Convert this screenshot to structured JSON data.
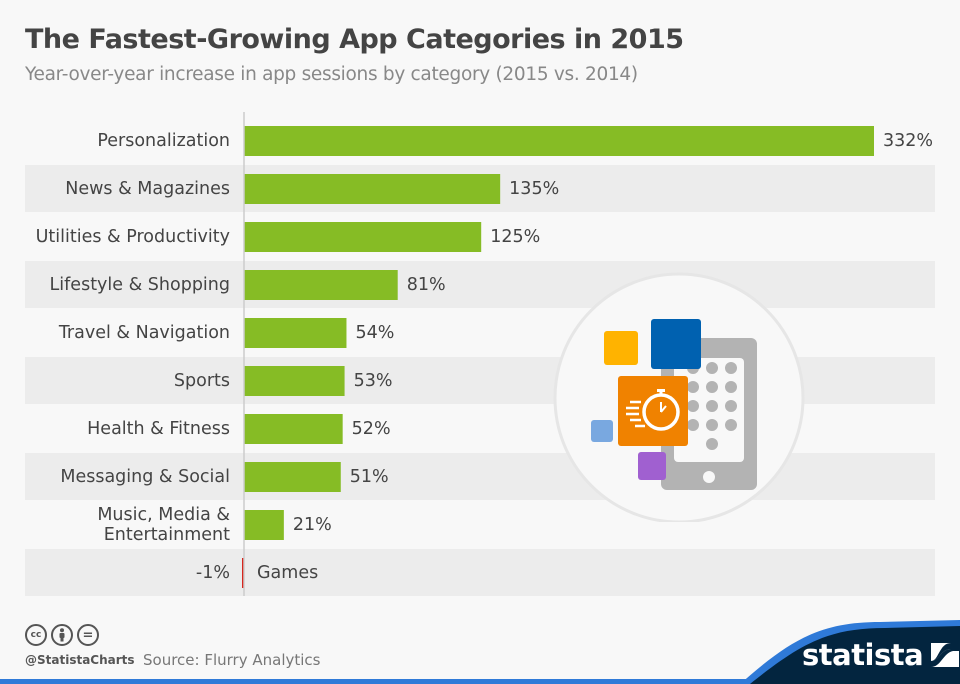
{
  "header": {
    "title": "The Fastest-Growing App Categories in 2015",
    "subtitle": "Year-over-year increase in app sessions by category (2015 vs. 2014)"
  },
  "chart_data": {
    "type": "bar",
    "orientation": "horizontal",
    "title": "The Fastest-Growing App Categories in 2015",
    "subtitle": "Year-over-year increase in app sessions by category (2015 vs. 2014)",
    "xlabel": "",
    "ylabel": "",
    "unit": "%",
    "categories": [
      "Personalization",
      "News & Magazines",
      "Utilities & Productivity",
      "Lifestyle & Shopping",
      "Travel & Navigation",
      "Sports",
      "Health & Fitness",
      "Messaging & Social",
      "Music, Media & Entertainment",
      "Games"
    ],
    "category_lines": [
      [
        "Personalization"
      ],
      [
        "News & Magazines"
      ],
      [
        "Utilities & Productivity"
      ],
      [
        "Lifestyle & Shopping"
      ],
      [
        "Travel & Navigation"
      ],
      [
        "Sports"
      ],
      [
        "Health & Fitness"
      ],
      [
        "Messaging & Social"
      ],
      [
        "Music, Media &",
        "Entertainment"
      ],
      [
        "Games"
      ]
    ],
    "values": [
      332,
      135,
      125,
      81,
      54,
      53,
      52,
      51,
      21,
      -1
    ],
    "value_labels": [
      "332%",
      "135%",
      "125%",
      "81%",
      "54%",
      "53%",
      "52%",
      "51%",
      "21%",
      "-1%"
    ],
    "xlim": [
      -1,
      332
    ],
    "grid": false,
    "legend": "none",
    "colors": {
      "positive": "#86bc25",
      "negative": "#d7261e",
      "stripe": "#ececec",
      "axis": "#cccccc"
    }
  },
  "illustration": {
    "icon": "smartphone-app-stopwatch-icon",
    "colors": {
      "yellow": "#ffb300",
      "blue": "#0061b0",
      "orange": "#f08200",
      "light_blue": "#79a8e0",
      "purple": "#a060d0",
      "phone": "#b3b3b3"
    }
  },
  "footer": {
    "license_icons": [
      "cc-icon",
      "by-icon",
      "nd-icon"
    ],
    "cc_label": "cc",
    "nd_label": "=",
    "handle": "@StatistaCharts",
    "source": "Source: Flurry Analytics",
    "logo_text": "statista",
    "colors": {
      "band_dark": "#03253f",
      "band_blue": "#2f7ad8"
    }
  }
}
